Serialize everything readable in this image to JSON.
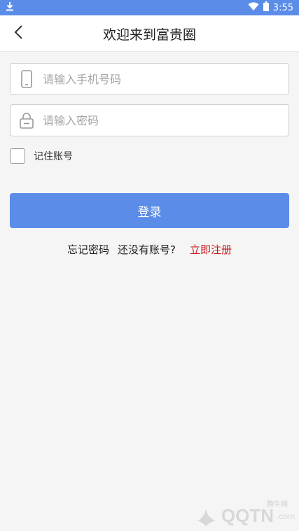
{
  "status_bar": {
    "time": "3:55",
    "download_icon": "download-arrow-icon",
    "wifi_icon": "wifi-icon",
    "battery_icon": "battery-icon"
  },
  "header": {
    "title": "欢迎来到富贵圈",
    "back_icon": "chevron-left-icon"
  },
  "form": {
    "phone_placeholder": "请输入手机号码",
    "password_placeholder": "请输入密码",
    "phone_icon": "phone-icon",
    "lock_icon": "lock-icon",
    "remember_label": "记住账号",
    "remember_checked": false,
    "login_label": "登录"
  },
  "links": {
    "forgot": "忘记密码",
    "no_account": "还没有账号?",
    "register": "立即注册"
  },
  "watermark": {
    "text": "QQTN",
    "suffix": ".com",
    "sub": "腾牛网"
  },
  "colors": {
    "accent": "#5b8de8",
    "register": "#c8171c",
    "background": "#f5f5f5"
  }
}
